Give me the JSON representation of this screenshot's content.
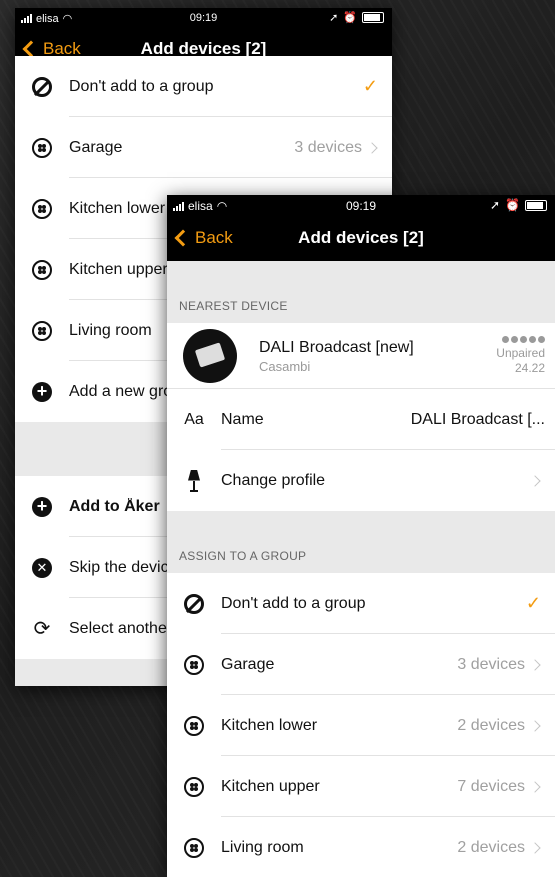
{
  "back_screen": {
    "status": {
      "carrier": "elisa",
      "time": "09:19"
    },
    "nav": {
      "back": "Back",
      "title": "Add devices [2]"
    },
    "groups": [
      {
        "label": "Don't add to a group",
        "checked": true,
        "icon": "no-group-icon"
      },
      {
        "label": "Garage",
        "detail": "3 devices",
        "icon": "group-icon"
      },
      {
        "label": "Kitchen lower",
        "icon": "group-icon"
      },
      {
        "label": "Kitchen upper",
        "icon": "group-icon"
      },
      {
        "label": "Living room",
        "icon": "group-icon"
      },
      {
        "label": "Add a new group",
        "icon": "plus-circle-icon"
      }
    ],
    "actions": [
      {
        "label": "Add to Åker",
        "icon": "plus-circle-icon"
      },
      {
        "label": "Skip the device",
        "icon": "x-circle-icon"
      },
      {
        "label": "Select another",
        "icon": "arrows-cycle-icon"
      }
    ]
  },
  "front_screen": {
    "status": {
      "carrier": "elisa",
      "time": "09:19"
    },
    "nav": {
      "back": "Back",
      "title": "Add devices [2]"
    },
    "nearest_device_header": "NEAREST DEVICE",
    "device": {
      "name": "DALI Broadcast [new]",
      "vendor": "Casambi",
      "status": "Unpaired",
      "value": "24.22"
    },
    "name_row": {
      "icon": "Aa",
      "label": "Name",
      "value": "DALI Broadcast [..."
    },
    "profile_row": {
      "label": "Change profile"
    },
    "assign_header": "ASSIGN TO A GROUP",
    "groups": [
      {
        "label": "Don't add to a group",
        "checked": true,
        "icon": "no-group-icon"
      },
      {
        "label": "Garage",
        "detail": "3 devices",
        "icon": "group-icon"
      },
      {
        "label": "Kitchen lower",
        "detail": "2 devices",
        "icon": "group-icon"
      },
      {
        "label": "Kitchen upper",
        "detail": "7 devices",
        "icon": "group-icon"
      },
      {
        "label": "Living room",
        "detail": "2 devices",
        "icon": "group-icon"
      }
    ]
  },
  "colors": {
    "accent": "#f39c12",
    "bar": "#000000",
    "section": "#e9e9e9"
  }
}
